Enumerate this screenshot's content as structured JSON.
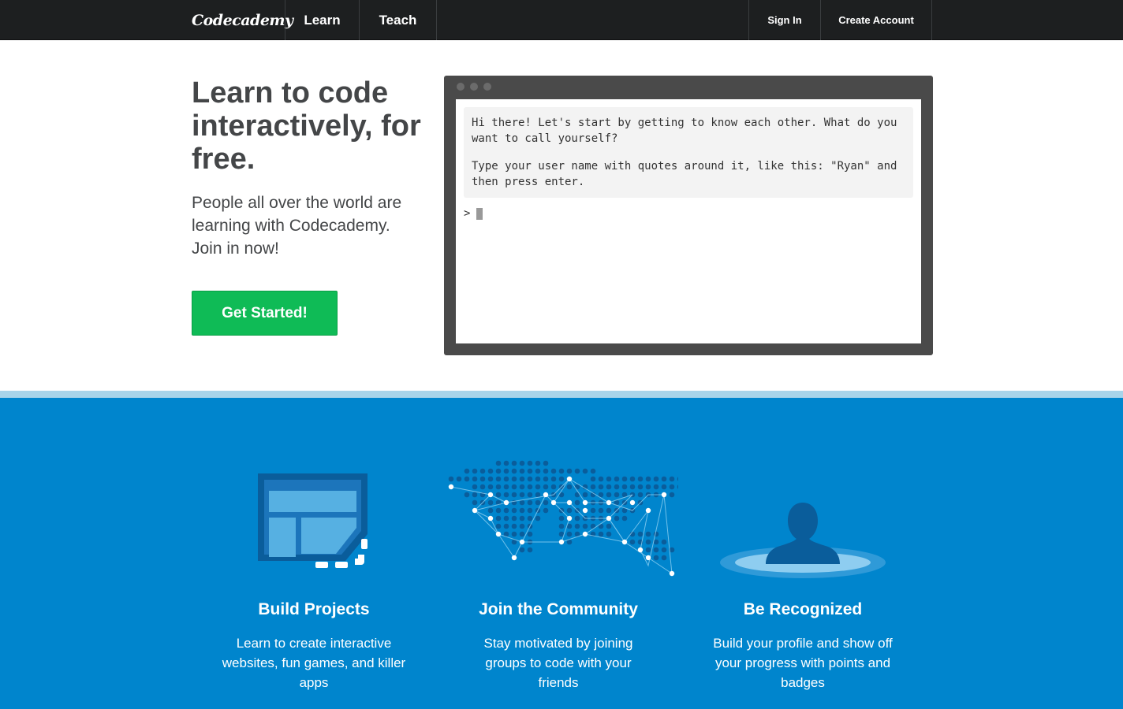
{
  "nav": {
    "logo": "Codecademy",
    "learn": "Learn",
    "teach": "Teach",
    "sign_in": "Sign In",
    "create_account": "Create Account"
  },
  "hero": {
    "title": "Learn to code interactively, for free.",
    "subtitle": "People all over the world are learning with Codecademy. Join in now!",
    "cta": "Get Started!"
  },
  "terminal": {
    "message_1": "Hi there! Let's start by getting to know each other. What do you want to call yourself?",
    "message_2": "Type your user name with quotes around it, like this: \"Ryan\" and then press enter.",
    "prompt": ">"
  },
  "features": [
    {
      "title": "Build Projects",
      "description": "Learn to create interactive websites, fun games, and killer apps",
      "icon": "projects-icon"
    },
    {
      "title": "Join the Community",
      "description": "Stay motivated by joining groups to code with your friends",
      "icon": "world-map-icon"
    },
    {
      "title": "Be Recognized",
      "description": "Build your profile and show off your progress with points and badges",
      "icon": "profile-icon"
    }
  ],
  "colors": {
    "nav_bg": "#1d1f20",
    "cta_green": "#0fbb56",
    "section_blue": "#0085cd",
    "stripe_light_blue": "#a8d4ea"
  }
}
